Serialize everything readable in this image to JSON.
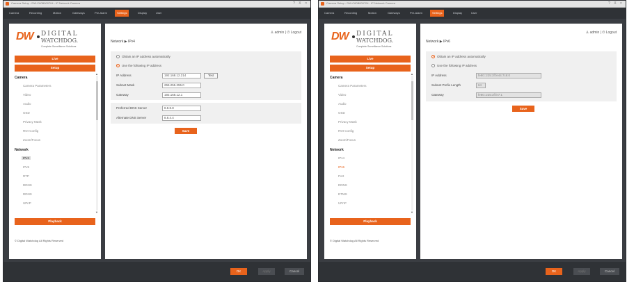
{
  "left": {
    "titlebar": {
      "title": "Camera Setup - DW-C60B000704 - IP Network Camera",
      "controls": "? X □"
    },
    "menu": [
      "Camera",
      "Recording",
      "Motion",
      "Gateways",
      "Pre-Alarm",
      "Settings",
      "Display",
      "User"
    ],
    "logo": {
      "line1": "DIGITAL",
      "line2": "WATCHDOG.",
      "tagline": "Complete Surveillance Solutions",
      "mark": "DW"
    },
    "sidebar": {
      "live_label": "Live",
      "setup_label": "Setup",
      "camera_heading": "Camera",
      "camera_items": [
        "Camera Parameters",
        "Video",
        "Audio",
        "OSD",
        "Privacy Mask",
        "ROI Config",
        "Zoom/Focus"
      ],
      "network_heading": "Network",
      "network_items": [
        "IPv4",
        "IPv6",
        "RTP",
        "DDNS",
        "DDNS",
        "UPnP"
      ],
      "playback_label": "Playback",
      "copyright": "© Digital Watchdog All Rights Reserved"
    },
    "content": {
      "user": "admin",
      "logout": "Logout",
      "breadcrumb": "Network ▶ IPv4",
      "radio_auto": "Obtain an IP address automatically",
      "radio_manual": "Use the following IP address",
      "ip_label": "IP Address",
      "ip_value": "192.168.12.214",
      "test_label": "Test",
      "mask_label": "Subnet Mask",
      "mask_value": "255.255.255.0",
      "gateway_label": "Gateway",
      "gateway_value": "192.168.12.1",
      "dns1_label": "Preferred DNS Server",
      "dns1_value": "8.8.8.8",
      "dns2_label": "Alternate DNS Server",
      "dns2_value": "8.8.4.4",
      "save_label": "Save"
    },
    "bottom": {
      "ok": "OK",
      "apply": "Apply",
      "cancel": "Cancel"
    }
  },
  "right": {
    "titlebar": {
      "title": "Camera Setup - DW-C60B000704 - IP Network Camera",
      "controls": "? X □"
    },
    "menu": [
      "Camera",
      "Recording",
      "Motion",
      "Gateways",
      "Pre-Alarm",
      "Settings",
      "Display",
      "User"
    ],
    "logo": {
      "line1": "DIGITAL",
      "line2": "WATCHDOG.",
      "tagline": "Complete Surveillance Solutions",
      "mark": "DW"
    },
    "sidebar": {
      "live_label": "Live",
      "setup_label": "Setup",
      "camera_heading": "Camera",
      "camera_items": [
        "Camera Parameters",
        "Video",
        "Audio",
        "OSD",
        "Privacy Mask",
        "ROI Config",
        "Zoom/Focus"
      ],
      "network_heading": "Network",
      "network_items": [
        "IPv4",
        "IPv6",
        "Port",
        "DDNS",
        "DTMS",
        "UPnP"
      ],
      "playback_label": "Playback",
      "copyright": "© Digital Watchdog All Rights Reserved"
    },
    "content": {
      "user": "admin",
      "logout": "Logout",
      "breadcrumb": "Network ▶ IPv6",
      "radio_auto": "Obtain an IP address automatically",
      "radio_manual": "Use the following IP address",
      "ip_label": "IP Address",
      "ip_value": "fe80::225:3f:fe44:7c6:0",
      "prefix_label": "Subnet Prefix Length",
      "prefix_value": "64",
      "gateway_label": "Gateway",
      "gateway_value": "fe80::225:3f:fe7:1",
      "save_label": "Save"
    },
    "bottom": {
      "ok": "OK",
      "apply": "Apply",
      "cancel": "Cancel"
    }
  }
}
